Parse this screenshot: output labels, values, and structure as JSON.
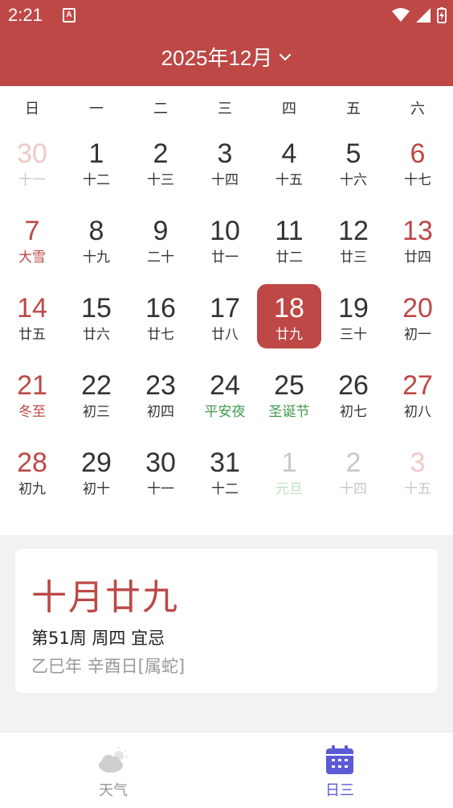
{
  "status_bar": {
    "time": "2:21",
    "notif_glyph": "A"
  },
  "header": {
    "title": "2025年12月"
  },
  "weekdays": [
    "日",
    "一",
    "二",
    "三",
    "四",
    "五",
    "六"
  ],
  "weeks": [
    [
      {
        "n": "30",
        "l": "十一",
        "c": "fade-red",
        "lc": "fade-gray"
      },
      {
        "n": "1",
        "l": "十二",
        "c": "black",
        "lc": "black"
      },
      {
        "n": "2",
        "l": "十三",
        "c": "black",
        "lc": "black"
      },
      {
        "n": "3",
        "l": "十四",
        "c": "black",
        "lc": "black"
      },
      {
        "n": "4",
        "l": "十五",
        "c": "black",
        "lc": "black"
      },
      {
        "n": "5",
        "l": "十六",
        "c": "black",
        "lc": "black"
      },
      {
        "n": "6",
        "l": "十七",
        "c": "red",
        "lc": "black"
      }
    ],
    [
      {
        "n": "7",
        "l": "大雪",
        "c": "red",
        "lc": "red"
      },
      {
        "n": "8",
        "l": "十九",
        "c": "black",
        "lc": "black"
      },
      {
        "n": "9",
        "l": "二十",
        "c": "black",
        "lc": "black"
      },
      {
        "n": "10",
        "l": "廿一",
        "c": "black",
        "lc": "black"
      },
      {
        "n": "11",
        "l": "廿二",
        "c": "black",
        "lc": "black"
      },
      {
        "n": "12",
        "l": "廿三",
        "c": "black",
        "lc": "black"
      },
      {
        "n": "13",
        "l": "廿四",
        "c": "red",
        "lc": "black"
      }
    ],
    [
      {
        "n": "14",
        "l": "廿五",
        "c": "red",
        "lc": "black"
      },
      {
        "n": "15",
        "l": "廿六",
        "c": "black",
        "lc": "black"
      },
      {
        "n": "16",
        "l": "廿七",
        "c": "black",
        "lc": "black"
      },
      {
        "n": "17",
        "l": "廿八",
        "c": "black",
        "lc": "black"
      },
      {
        "n": "18",
        "l": "廿九",
        "c": "black",
        "lc": "black",
        "selected": true
      },
      {
        "n": "19",
        "l": "三十",
        "c": "black",
        "lc": "black"
      },
      {
        "n": "20",
        "l": "初一",
        "c": "red",
        "lc": "black"
      }
    ],
    [
      {
        "n": "21",
        "l": "冬至",
        "c": "red",
        "lc": "red"
      },
      {
        "n": "22",
        "l": "初三",
        "c": "black",
        "lc": "black"
      },
      {
        "n": "23",
        "l": "初四",
        "c": "black",
        "lc": "black"
      },
      {
        "n": "24",
        "l": "平安夜",
        "c": "black",
        "lc": "green"
      },
      {
        "n": "25",
        "l": "圣诞节",
        "c": "black",
        "lc": "green"
      },
      {
        "n": "26",
        "l": "初七",
        "c": "black",
        "lc": "black"
      },
      {
        "n": "27",
        "l": "初八",
        "c": "red",
        "lc": "black"
      }
    ],
    [
      {
        "n": "28",
        "l": "初九",
        "c": "red",
        "lc": "black"
      },
      {
        "n": "29",
        "l": "初十",
        "c": "black",
        "lc": "black"
      },
      {
        "n": "30",
        "l": "十一",
        "c": "black",
        "lc": "black"
      },
      {
        "n": "31",
        "l": "十二",
        "c": "black",
        "lc": "black"
      },
      {
        "n": "1",
        "l": "元旦",
        "c": "fade-gray",
        "lc": "fade-green"
      },
      {
        "n": "2",
        "l": "十四",
        "c": "fade-gray",
        "lc": "fade-gray"
      },
      {
        "n": "3",
        "l": "十五",
        "c": "fade-red",
        "lc": "fade-gray"
      }
    ]
  ],
  "info": {
    "lunar_date": "十月廿九",
    "line1": "第51周 周四 宜忌",
    "line2": "乙巳年 辛酉日[属蛇]"
  },
  "bottom_nav": {
    "weather_label": "天气",
    "calendar_label": "日三"
  },
  "colors": {
    "accent": "#bd4846",
    "nav_active": "#5b5bd6",
    "nav_inactive": "#999999"
  },
  "icons": {
    "weather": "cloud-sun-icon",
    "calendar": "calendar-icon",
    "chevron": "chevron-down-icon"
  }
}
